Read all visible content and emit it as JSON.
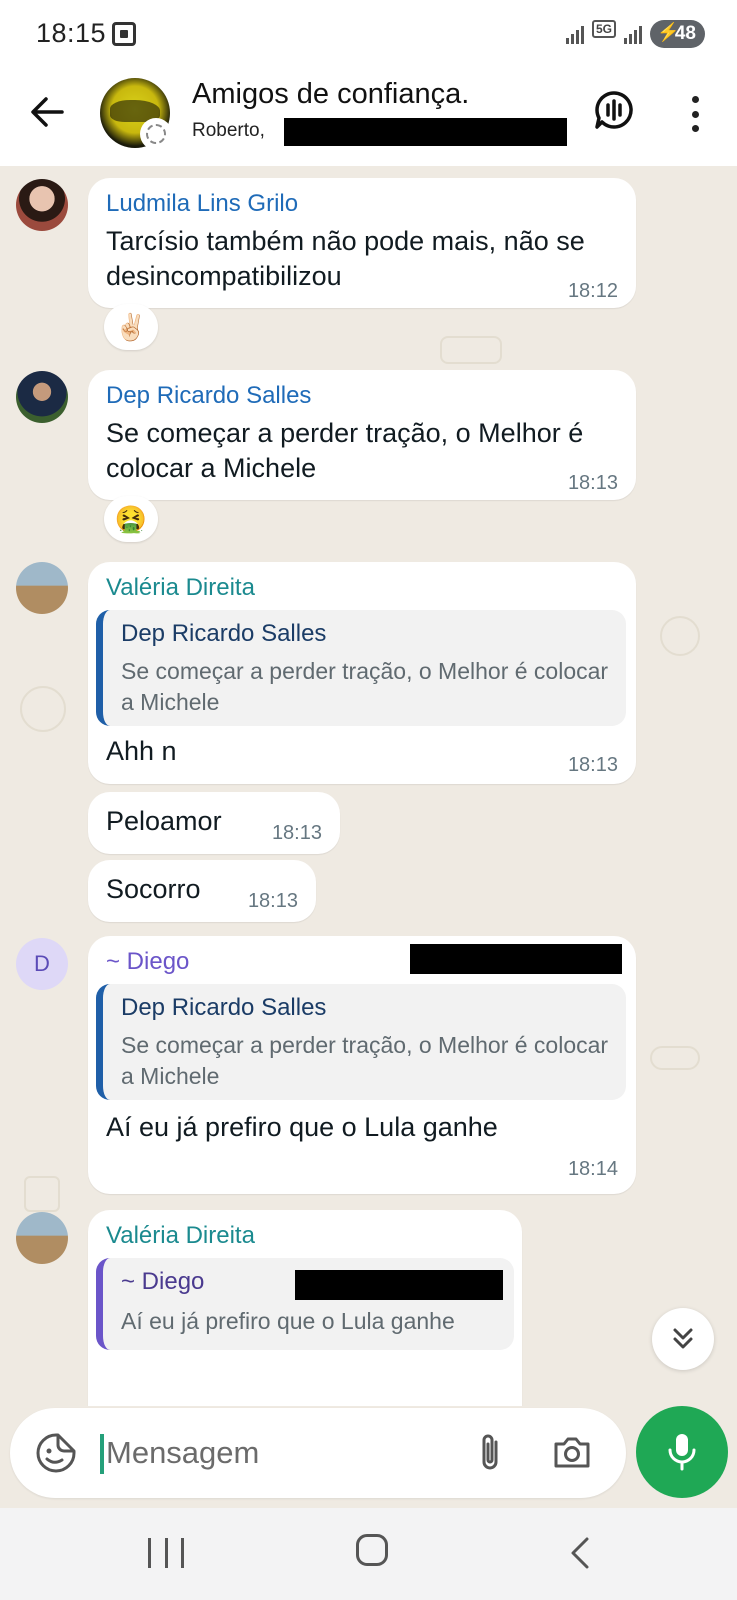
{
  "status_bar": {
    "time": "18:15",
    "network": "5G",
    "battery": "48"
  },
  "header": {
    "title": "Amigos de confiança.",
    "members": "Roberto,"
  },
  "messages": [
    {
      "sender": "Ludmila Lins Grilo",
      "sender_color": "#1f6bb8",
      "text": "Tarcísio também não pode mais, não se desincompatibilizou",
      "time": "18:12",
      "reaction": "✌🏻"
    },
    {
      "sender": "Dep Ricardo Salles",
      "sender_color": "#1f6bb8",
      "text": "Se começar a perder tração, o Melhor é colocar a Michele",
      "time": "18:13",
      "reaction": "🤮"
    },
    {
      "sender": "Valéria Direita",
      "sender_color": "#1b8a8f",
      "quote_name": "Dep Ricardo Salles",
      "quote_text": "Se começar a perder tração, o Melhor é colocar a Michele",
      "text": "Ahh n",
      "time": "18:13"
    },
    {
      "text": "Peloamor",
      "time": "18:13"
    },
    {
      "text": "Socorro",
      "time": "18:13"
    },
    {
      "sender": "~ Diego",
      "sender_color": "#6b55c9",
      "avatar_letter": "D",
      "quote_name": "Dep Ricardo Salles",
      "quote_text": "Se começar a perder tração, o Melhor é colocar a Michele",
      "text": "Aí eu já prefiro que o Lula ganhe",
      "time": "18:14"
    },
    {
      "sender": "Valéria Direita",
      "sender_color": "#1b8a8f",
      "quote_name": "~ Diego",
      "quote_text": "Aí eu já prefiro que o Lula ganhe"
    }
  ],
  "composer": {
    "placeholder": "Mensagem"
  },
  "icons": {
    "back": "arrow-left-icon",
    "call": "voice-chat-icon",
    "menu": "more-vert-icon",
    "emoji": "sticker-icon",
    "attach": "paperclip-icon",
    "camera": "camera-icon",
    "mic": "microphone-icon",
    "scroll": "double-chevron-down-icon"
  },
  "colors": {
    "accent": "#1fa855",
    "chat_bg": "#efeae2",
    "quote_bar_blue": "#1f5fa8",
    "quote_bar_purple": "#6b55c9"
  }
}
